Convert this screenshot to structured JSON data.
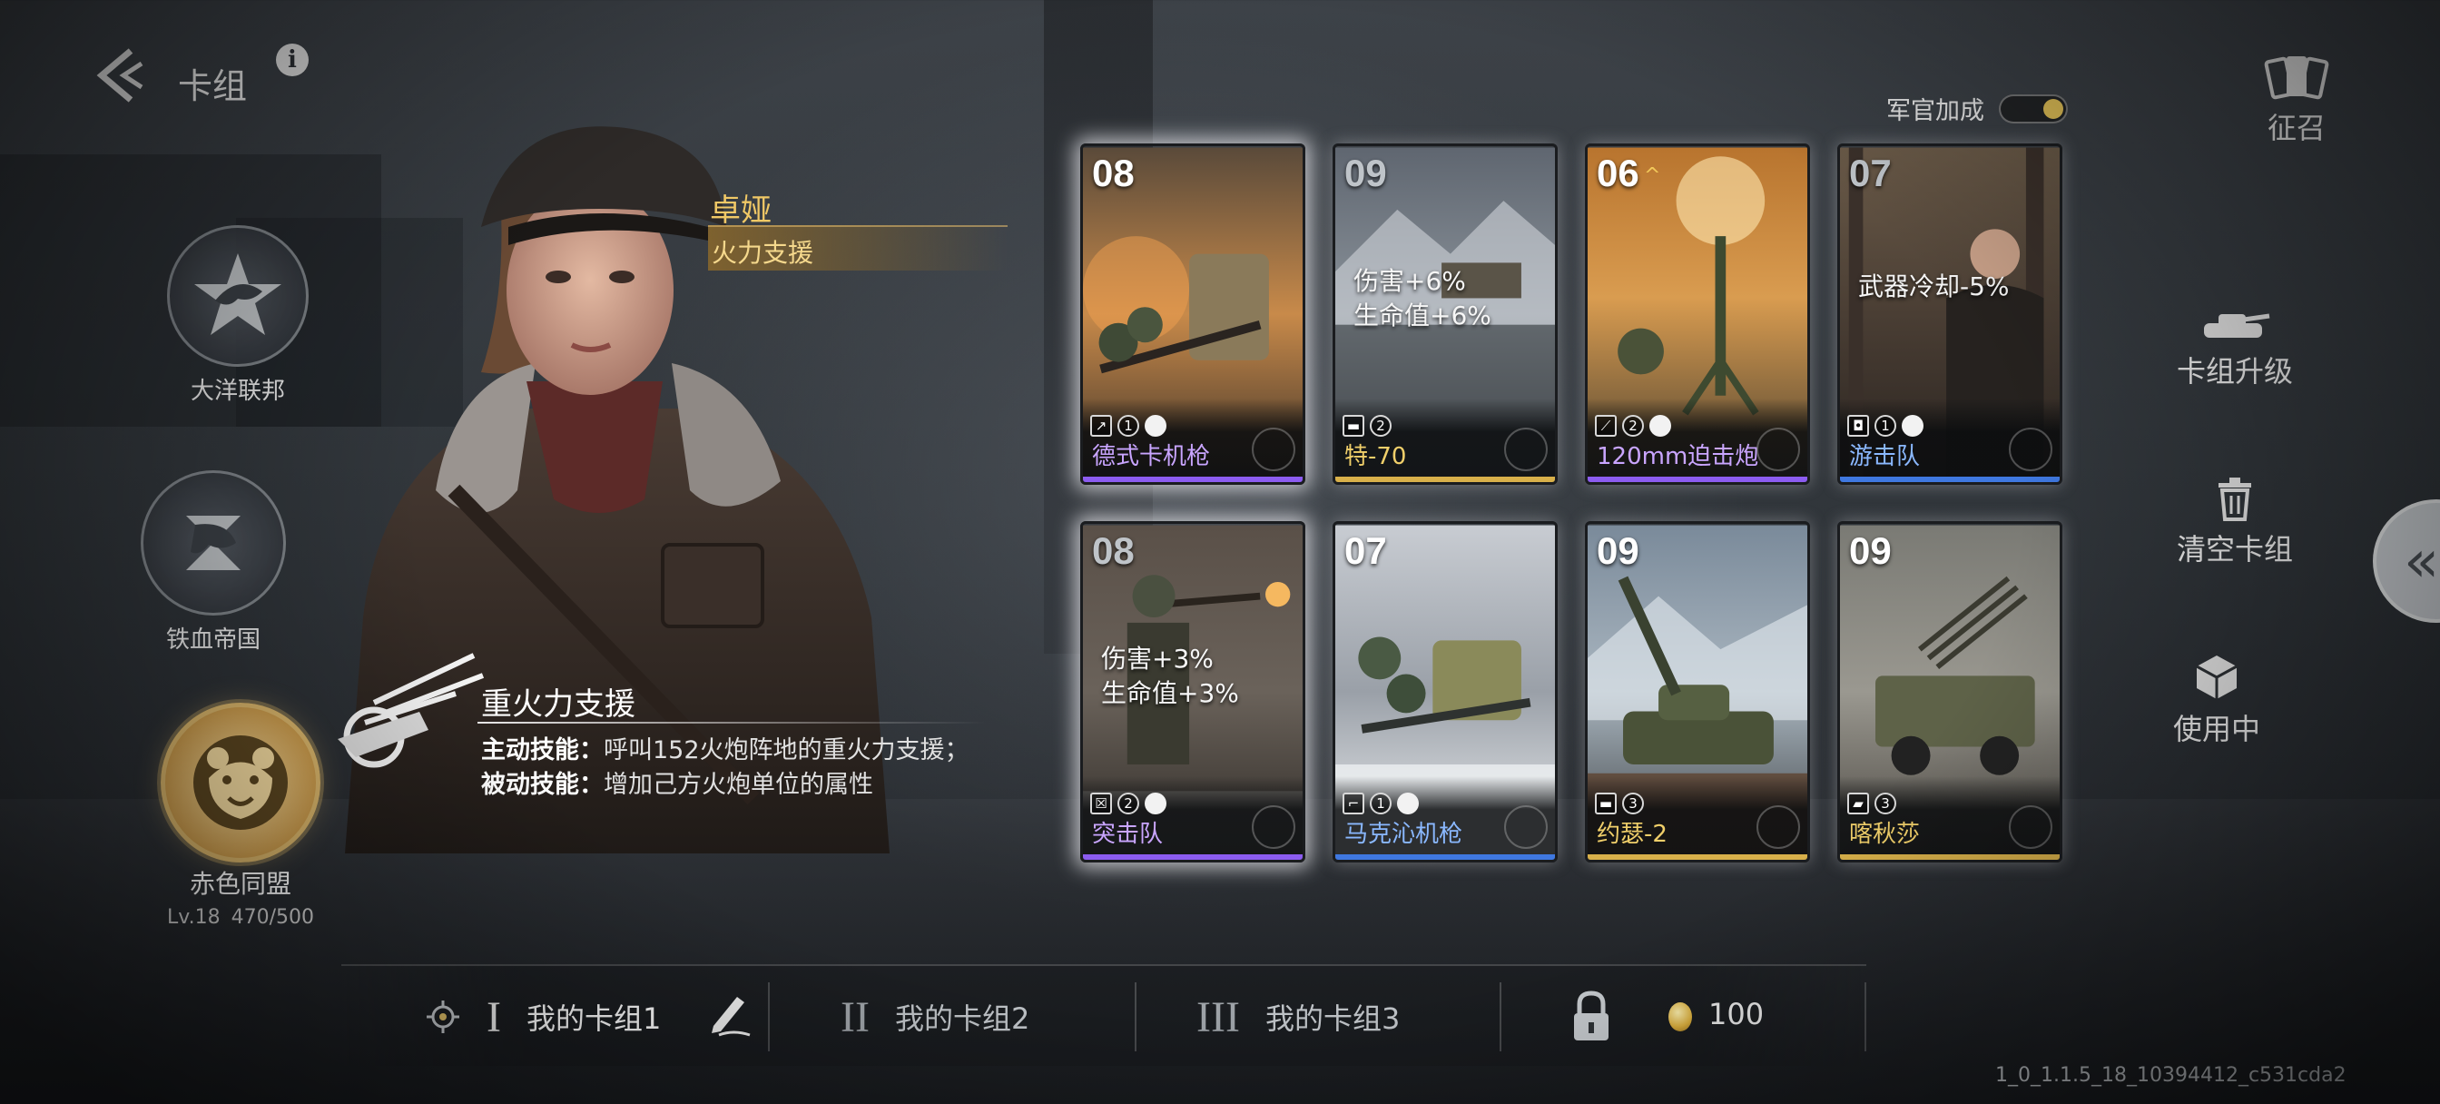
{
  "header": {
    "title": "卡组",
    "info_icon": "info-icon",
    "back_icon": "back-arrow-icon"
  },
  "factions": [
    {
      "name": "大洋联邦",
      "icon": "star-eagle-emblem"
    },
    {
      "name": "铁血帝国",
      "icon": "panther-emblem"
    },
    {
      "name": "赤色同盟",
      "icon": "bear-emblem",
      "selected": true,
      "level": "Lv.18",
      "exp": "470/500"
    }
  ],
  "commander": {
    "name": "卓娅",
    "role": "火力支援"
  },
  "skill": {
    "title": "重火力支援",
    "active_label": "主动技能：",
    "active_text": "呼叫152火炮阵地的重火力支援；",
    "passive_label": "被动技能：",
    "passive_text": "增加己方火炮单位的属性"
  },
  "officer_bonus": {
    "label": "军官加成",
    "enabled": true
  },
  "cards": [
    {
      "cost": "08",
      "name": "德式卡机枪",
      "rarity": "purple",
      "buffs": [],
      "tag_count": "1"
    },
    {
      "cost": "09",
      "name": "特-70",
      "rarity": "gold",
      "buffs": [
        "伤害+6%",
        "生命值+6%"
      ],
      "tag_count": "2"
    },
    {
      "cost": "06",
      "name": "120mm迫击炮",
      "rarity": "purple",
      "buffs": [],
      "tag_count": "2",
      "upgrade": "^"
    },
    {
      "cost": "07",
      "name": "游击队",
      "rarity": "blue",
      "buffs": [
        "武器冷却-5%"
      ],
      "tag_count": "1"
    },
    {
      "cost": "08",
      "name": "突击队",
      "rarity": "purple",
      "buffs": [
        "伤害+3%",
        "生命值+3%"
      ],
      "tag_count": "2"
    },
    {
      "cost": "07",
      "name": "马克沁机枪",
      "rarity": "blue",
      "buffs": [],
      "tag_count": "1"
    },
    {
      "cost": "09",
      "name": "约瑟-2",
      "rarity": "gold",
      "buffs": [],
      "tag_count": "3"
    },
    {
      "cost": "09",
      "name": "喀秋莎",
      "rarity": "gold",
      "buffs": [],
      "tag_count": "3"
    }
  ],
  "right_menu": {
    "recruit": "征召",
    "upgrade": "卡组升级",
    "clear": "清空卡组",
    "in_use": "使用中"
  },
  "decks": [
    {
      "numeral": "I",
      "name": "我的卡组1",
      "active": true
    },
    {
      "numeral": "II",
      "name": "我的卡组2"
    },
    {
      "numeral": "III",
      "name": "我的卡组3"
    }
  ],
  "currency": {
    "value": "100",
    "icon": "coin-icon"
  },
  "version": "1_0_1.1.5_18_10394412_c531cda2",
  "colors": {
    "gold": "#f0c866",
    "purple": "#8c5cf0",
    "blue": "#3f78e0"
  }
}
